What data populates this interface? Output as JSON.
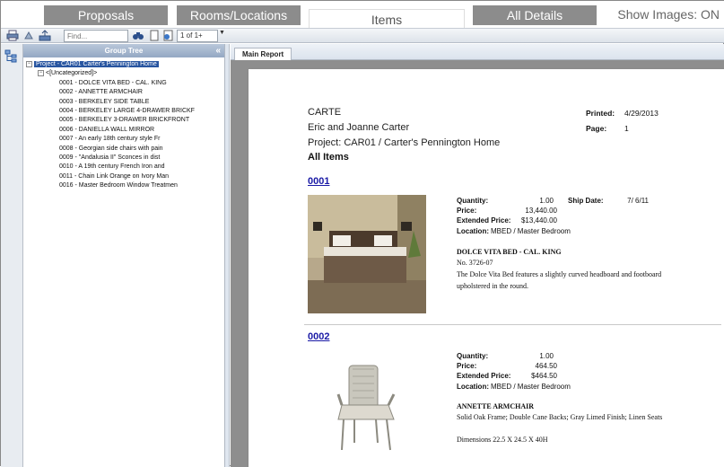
{
  "tabs": [
    {
      "label": "Proposals"
    },
    {
      "label": "Rooms/Locations"
    },
    {
      "label": "Items"
    },
    {
      "label": "All Details"
    }
  ],
  "show_images": "Show Images: ON",
  "toolbar": {
    "find_placeholder": "Find...",
    "page_indicator": "1 of 1+"
  },
  "group_tree": {
    "title": "Group Tree",
    "root": "Project - CAR01 Carter's Pennington Home",
    "group": "<[Uncategorized]>",
    "items": [
      "0001 - DOLCE VITA BED - CAL. KING",
      "0002 - ANNETTE ARMCHAIR",
      "0003 - BERKELEY SIDE TABLE",
      "0004 - BERKELEY LARGE 4-DRAWER BRICKF",
      "0005 - BERKELEY 3-DRAWER BRICKFRONT",
      "0006 - DANIELLA WALL MIRROR",
      "0007 - An early 18th century style Fr",
      "0008 - Georgian side chairs with pain",
      "0009 - \"Andalusia II\" Sconces in dist",
      "0010 - A 19th century French Iron and",
      "0011 - Chain Link Orange on Ivory Man",
      "0016 - Master Bedroom Window Treatmen"
    ]
  },
  "report": {
    "tab_label": "Main Report",
    "company": "CARTE",
    "client": "Eric and Joanne Carter",
    "project": "Project: CAR01 / Carter's Pennington Home",
    "heading": "All Items",
    "printed_label": "Printed:",
    "printed_value": "4/29/2013",
    "page_label": "Page:",
    "page_value": "1",
    "labels": {
      "quantity": "Quantity:",
      "price": "Price:",
      "extended_price": "Extended Price:",
      "location": "Location:",
      "ship_date": "Ship Date:"
    },
    "items": [
      {
        "number": "0001",
        "quantity": "1.00",
        "price": "13,440.00",
        "extended_price": "$13,440.00",
        "location": "MBED / Master Bedroom",
        "ship_date": "7/ 6/11",
        "title": "DOLCE VITA BED - CAL. KING",
        "line1": "No. 3726-07",
        "line2": "The Dolce Vita Bed features a slightly curved headboard and footboard upholstered in the round."
      },
      {
        "number": "0002",
        "quantity": "1.00",
        "price": "464.50",
        "extended_price": "$464.50",
        "location": "MBED / Master Bedroom",
        "title": "ANNETTE ARMCHAIR",
        "line1": "Solid Oak Frame; Double Cane Backs; Gray Limed Finish; Linen Seats",
        "line2": "Dimensions 22.5 X 24.5 X 40H"
      }
    ]
  }
}
